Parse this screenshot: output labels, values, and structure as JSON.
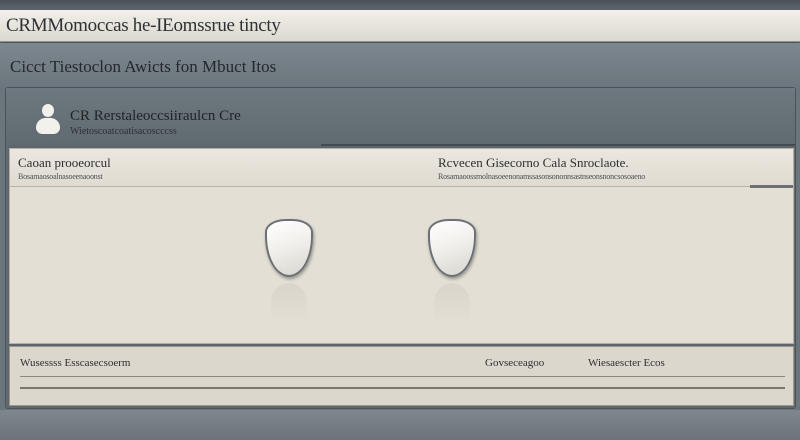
{
  "window": {
    "title": "CRMMomoccas he-IEomssrue tincty"
  },
  "subheader": {
    "title": "Cicct Tiestoclon Awicts fon Mbuct Itos"
  },
  "profile": {
    "name": "CR Rerstaleoccsiiraulcn Cre",
    "meta": "Wietoscoatcoatisacoscccss"
  },
  "panel": {
    "left_title": "Caoan prooeorcul",
    "left_sub": "Bosamaosoalnasoeenaoonst",
    "right_title": "Rcvecen Gisecorno Cala Snroclaote.",
    "right_sub": "Rosamaoossmolnasoeenonamssasonsononnsastnseonsnoncsosoaeno"
  },
  "footer": {
    "left_label": "Wusessss Esscasecsoerm",
    "mid_label": "Govseceagoo",
    "right_label": "Wiesaescter Ecos"
  },
  "icons": {
    "user": "user-icon",
    "shield_left": "shield-icon",
    "shield_right": "shield-icon"
  },
  "colors": {
    "background": "#6b757c",
    "panel": "#e4dfd5",
    "titlebar": "#e8e5dd",
    "text": "#2b2f33"
  }
}
